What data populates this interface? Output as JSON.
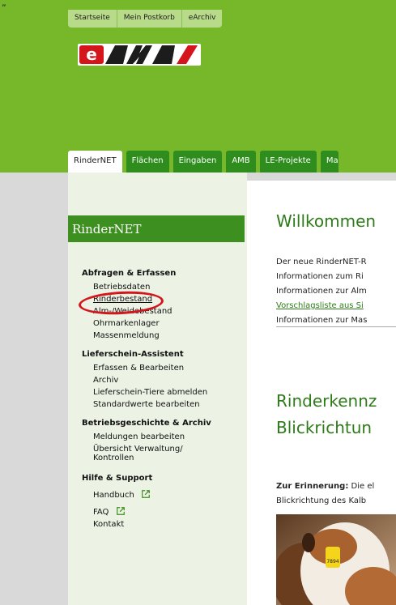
{
  "top_mark": "„",
  "top_links": [
    "Startseite",
    "Mein Postkorb",
    "eArchiv"
  ],
  "logo": {
    "text": "eAMA",
    "colors": {
      "red": "#d4151c",
      "white": "#ffffff",
      "black": "#1c1c1c"
    }
  },
  "tabs": [
    {
      "label": "RinderNET",
      "active": true
    },
    {
      "label": "Flächen"
    },
    {
      "label": "Eingaben"
    },
    {
      "label": "AMB"
    },
    {
      "label": "LE-Projekte"
    },
    {
      "label": "Ma"
    }
  ],
  "sidebar": {
    "title": "RinderNET",
    "groups": [
      {
        "title": "Abfragen & Erfassen",
        "items": [
          "Betriebsdaten",
          "Rinderbestand",
          "Alm-/Weidebestand",
          "Ohrmarkenlager",
          "Massenmeldung"
        ]
      },
      {
        "title": "Lieferschein-Assistent",
        "items": [
          "Erfassen & Bearbeiten",
          "Archiv",
          "Lieferschein-Tiere abmelden",
          "Standardwerte bearbeiten"
        ]
      },
      {
        "title": "Betriebsgeschichte & Archiv",
        "items": [
          "Meldungen bearbeiten",
          "Übersicht Verwaltung/",
          "Kontrollen"
        ]
      },
      {
        "title": "Hilfe & Support",
        "items": [
          "Handbuch",
          "FAQ",
          "Kontakt"
        ]
      }
    ]
  },
  "main": {
    "heading1": "Willkommen",
    "intro_lines": [
      "Der neue RinderNET-R",
      "Informationen zum Ri",
      "Informationen zur Alm",
      "Vorschlagsliste aus Si",
      "Informationen zur Mas"
    ],
    "heading2_line1": "Rinderkennz",
    "heading2_line2": "Blickrichtun",
    "reminder_bold": "Zur Erinnerung:",
    "reminder_rest": " Die el",
    "reminder_line2": "Blickrichtung des Kalb",
    "ear_tag_number": "7894"
  },
  "colors": {
    "green": "#76b82a",
    "dark_green": "#3d8f1f",
    "tab_green": "#2f8d1e",
    "text_green": "#2e7b1a",
    "highlight": "#d4151c"
  }
}
